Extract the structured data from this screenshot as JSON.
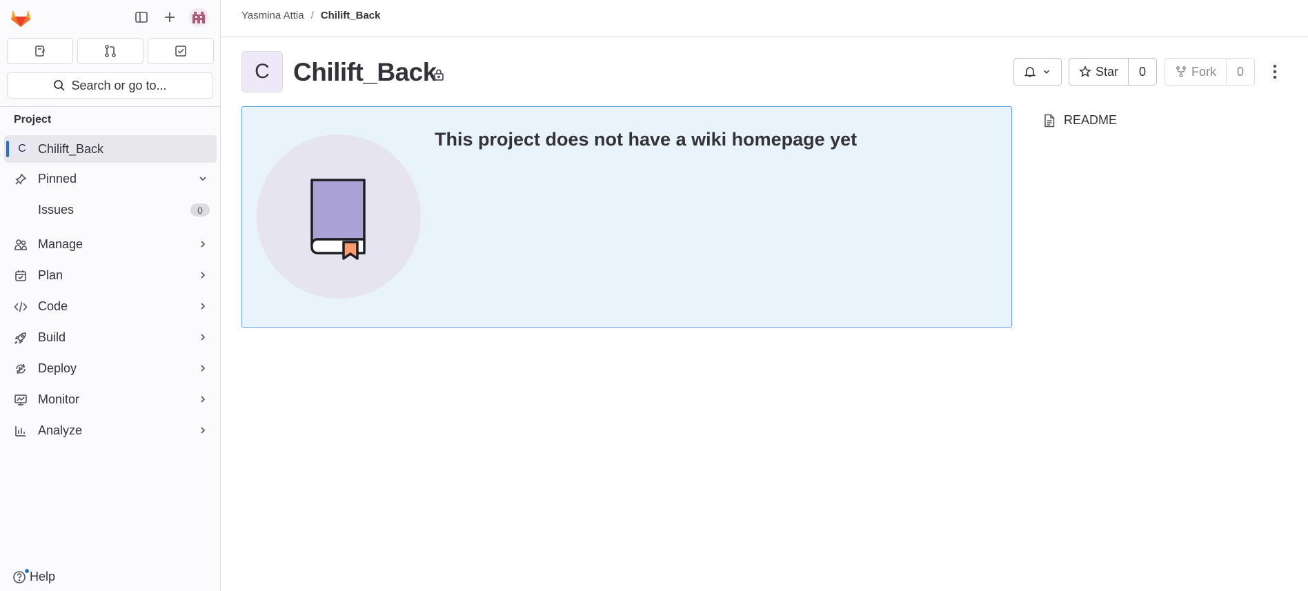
{
  "sidebar": {
    "search_label": "Search or go to...",
    "section_label": "Project",
    "project_item": {
      "letter": "C",
      "label": "Chilift_Back"
    },
    "pinned": {
      "label": "Pinned"
    },
    "issues": {
      "label": "Issues",
      "count": "0"
    },
    "menu": [
      {
        "label": "Manage",
        "icon": "users-icon"
      },
      {
        "label": "Plan",
        "icon": "calendar-icon"
      },
      {
        "label": "Code",
        "icon": "code-icon"
      },
      {
        "label": "Build",
        "icon": "rocket-icon"
      },
      {
        "label": "Deploy",
        "icon": "deploy-icon"
      },
      {
        "label": "Monitor",
        "icon": "monitor-icon"
      },
      {
        "label": "Analyze",
        "icon": "chart-icon"
      }
    ],
    "help_label": "Help"
  },
  "breadcrumb": {
    "owner": "Yasmina Attia",
    "separator": "/",
    "current": "Chilift_Back"
  },
  "project": {
    "avatar_letter": "C",
    "title": "Chilift_Back",
    "star_label": "Star",
    "star_count": "0",
    "fork_label": "Fork",
    "fork_count": "0"
  },
  "wiki": {
    "empty_title": "This project does not have a wiki homepage yet"
  },
  "right_panel": {
    "readme_label": "README"
  },
  "colors": {
    "accent": "#1f75cb",
    "sidebar_bg": "#fbfafd",
    "empty_bg": "#e9f3fc",
    "empty_border": "#63a6e9",
    "book_cover": "#aba3d6",
    "bookmark": "#fc9b6f"
  }
}
